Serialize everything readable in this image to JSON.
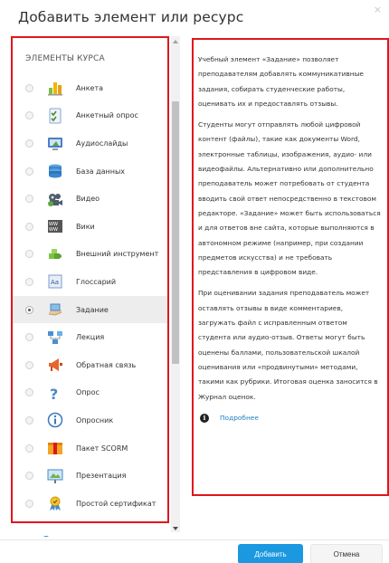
{
  "dialog": {
    "title": "Добавить элемент или ресурс",
    "close_label": "×"
  },
  "module_list": {
    "section_title": "ЭЛЕМЕНТЫ КУРСА",
    "items": [
      {
        "label": "Анкета",
        "icon": "bar-chart-icon",
        "selected": false
      },
      {
        "label": "Анкетный опрос",
        "icon": "survey-checklist-icon",
        "selected": false
      },
      {
        "label": "Аудиослайды",
        "icon": "audio-slides-icon",
        "selected": false
      },
      {
        "label": "База данных",
        "icon": "database-icon",
        "selected": false
      },
      {
        "label": "Видео",
        "icon": "video-icon",
        "selected": false
      },
      {
        "label": "Вики",
        "icon": "wiki-icon",
        "selected": false
      },
      {
        "label": "Внешний инструмент",
        "icon": "puzzle-icon",
        "selected": false
      },
      {
        "label": "Глоссарий",
        "icon": "glossary-icon",
        "selected": false
      },
      {
        "label": "Задание",
        "icon": "assignment-hand-icon",
        "selected": true
      },
      {
        "label": "Лекция",
        "icon": "lesson-icon",
        "selected": false
      },
      {
        "label": "Обратная связь",
        "icon": "megaphone-icon",
        "selected": false
      },
      {
        "label": "Опрос",
        "icon": "question-mark-icon",
        "selected": false
      },
      {
        "label": "Опросник",
        "icon": "info-circle-icon",
        "selected": false
      },
      {
        "label": "Пакет SCORM",
        "icon": "scorm-package-icon",
        "selected": false
      },
      {
        "label": "Презентация",
        "icon": "presentation-icon",
        "selected": false
      },
      {
        "label": "Простой сертификат",
        "icon": "certificate-icon",
        "selected": false
      }
    ]
  },
  "description": {
    "paragraphs": [
      "Учебный элемент «Задание» позволяет преподавателям добавлять коммуникативные задания, собирать студенческие работы, оценивать их и предоставлять отзывы.",
      "Студенты могут отправлять любой цифровой контент (файлы), такие как документы Word, электронные таблицы, изображения, аудио- или видеофайлы. Альтернативно или дополнительно преподаватель может потребовать от студента вводить свой ответ непосредственно в текстовом редакторе. «Задание» может быть использоваться и для ответов вне сайта, которые выполняются в автономном режиме (например, при создании предметов искусства) и не требовать представления в цифровом виде.",
      "При оценивании задания преподаватель может оставлять отзывы в виде комментариев, загружать файл с исправленным ответом студента или аудио-отзыв. Ответы могут быть оценены баллами, пользовательской шкалой оценивания или «продвинутыми» методами, такими как рубрики. Итоговая оценка заносится в Журнал оценок."
    ],
    "more_link": "Подробнее"
  },
  "footer": {
    "add_label": "Добавить",
    "cancel_label": "Отмена"
  },
  "colors": {
    "highlight_border": "#e0161d",
    "primary_button": "#1b98e0",
    "link": "#1b7ec2"
  }
}
